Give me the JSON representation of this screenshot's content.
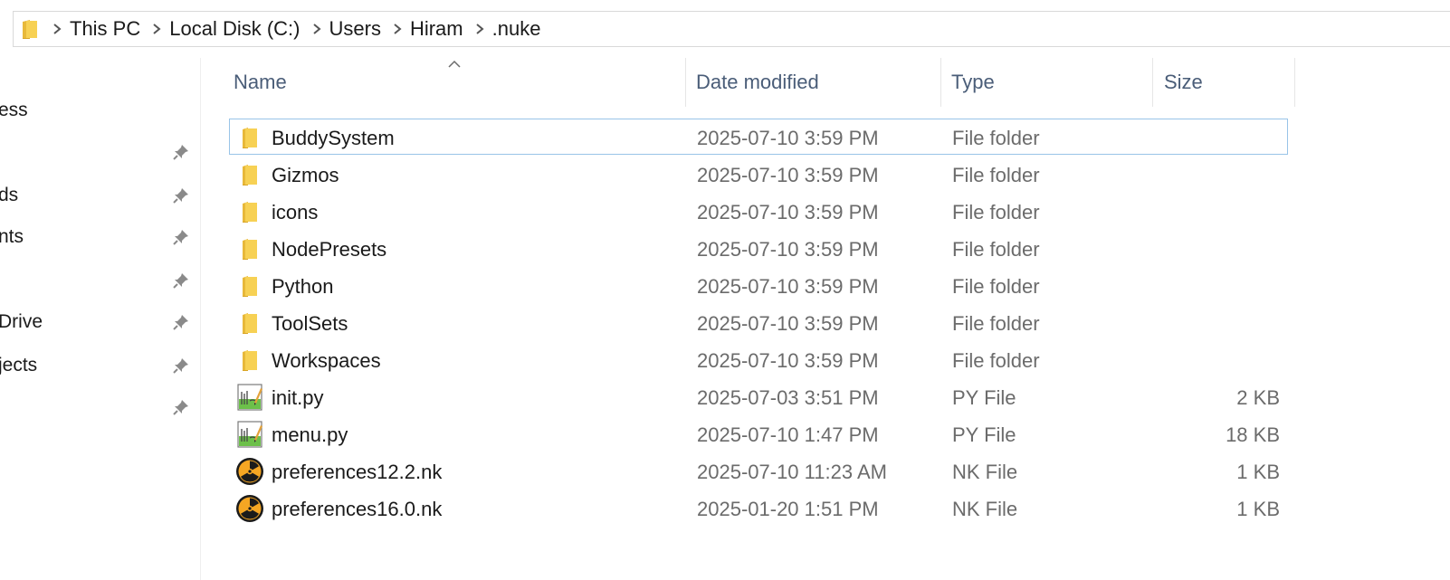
{
  "breadcrumb": [
    {
      "label": "This PC"
    },
    {
      "label": "Local Disk (C:)"
    },
    {
      "label": "Users"
    },
    {
      "label": "Hiram"
    },
    {
      "label": ".nuke"
    }
  ],
  "nav": {
    "items": [
      {
        "label": "ess",
        "pinned": false
      },
      {
        "label": "",
        "pinned": true
      },
      {
        "label": "ds",
        "pinned": true
      },
      {
        "label": "nts",
        "pinned": true
      },
      {
        "label": "",
        "pinned": true
      },
      {
        "label": "Drive",
        "pinned": true
      },
      {
        "label": "jects",
        "pinned": true
      },
      {
        "label": "",
        "pinned": true
      }
    ]
  },
  "columns": {
    "name": "Name",
    "date": "Date modified",
    "type": "Type",
    "size": "Size"
  },
  "files": [
    {
      "name": "BuddySystem",
      "date": "2025-07-10 3:59 PM",
      "type": "File folder",
      "size": "",
      "icon": "folder-icon",
      "selected": true
    },
    {
      "name": "Gizmos",
      "date": "2025-07-10 3:59 PM",
      "type": "File folder",
      "size": "",
      "icon": "folder-icon"
    },
    {
      "name": "icons",
      "date": "2025-07-10 3:59 PM",
      "type": "File folder",
      "size": "",
      "icon": "folder-icon"
    },
    {
      "name": "NodePresets",
      "date": "2025-07-10 3:59 PM",
      "type": "File folder",
      "size": "",
      "icon": "folder-icon"
    },
    {
      "name": "Python",
      "date": "2025-07-10 3:59 PM",
      "type": "File folder",
      "size": "",
      "icon": "folder-icon"
    },
    {
      "name": "ToolSets",
      "date": "2025-07-10 3:59 PM",
      "type": "File folder",
      "size": "",
      "icon": "folder-icon"
    },
    {
      "name": "Workspaces",
      "date": "2025-07-10 3:59 PM",
      "type": "File folder",
      "size": "",
      "icon": "folder-icon"
    },
    {
      "name": "init.py",
      "date": "2025-07-03 3:51 PM",
      "type": "PY File",
      "size": "2 KB",
      "icon": "python-file-icon"
    },
    {
      "name": "menu.py",
      "date": "2025-07-10 1:47 PM",
      "type": "PY File",
      "size": "18 KB",
      "icon": "python-file-icon"
    },
    {
      "name": "preferences12.2.nk",
      "date": "2025-07-10 11:23 AM",
      "type": "NK File",
      "size": "1 KB",
      "icon": "nuke-file-icon"
    },
    {
      "name": "preferences16.0.nk",
      "date": "2025-01-20 1:51 PM",
      "type": "NK File",
      "size": "1 KB",
      "icon": "nuke-file-icon"
    }
  ],
  "colors": {
    "folder": "#f5c542",
    "selection_border": "#99c4e8",
    "header_text": "#4a5d78",
    "secondary_text": "#6b6b6b"
  }
}
